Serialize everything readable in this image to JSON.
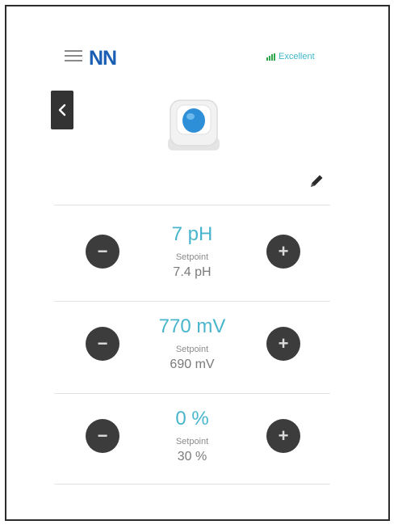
{
  "header": {
    "logo": "NN",
    "connection_status": "Excellent",
    "icons": {
      "menu": "hamburger-menu-icon",
      "signal": "signal-icon",
      "back": "chevron-left-icon",
      "edit": "pencil-icon"
    }
  },
  "device": {
    "image": "device-image"
  },
  "controls": [
    {
      "value": "7 pH",
      "setpoint_label": "Setpoint",
      "setpoint_value": "7.4 pH"
    },
    {
      "value": "770 mV",
      "setpoint_label": "Setpoint",
      "setpoint_value": "690 mV"
    },
    {
      "value": "0 %",
      "setpoint_label": "Setpoint",
      "setpoint_value": "30 %"
    }
  ],
  "buttons": {
    "minus_label": "−",
    "plus_label": "+"
  },
  "colors": {
    "accent": "#48b5cc",
    "logo": "#1a5fb4",
    "button": "#3c3c3c",
    "connection": "#3fb7c9"
  }
}
